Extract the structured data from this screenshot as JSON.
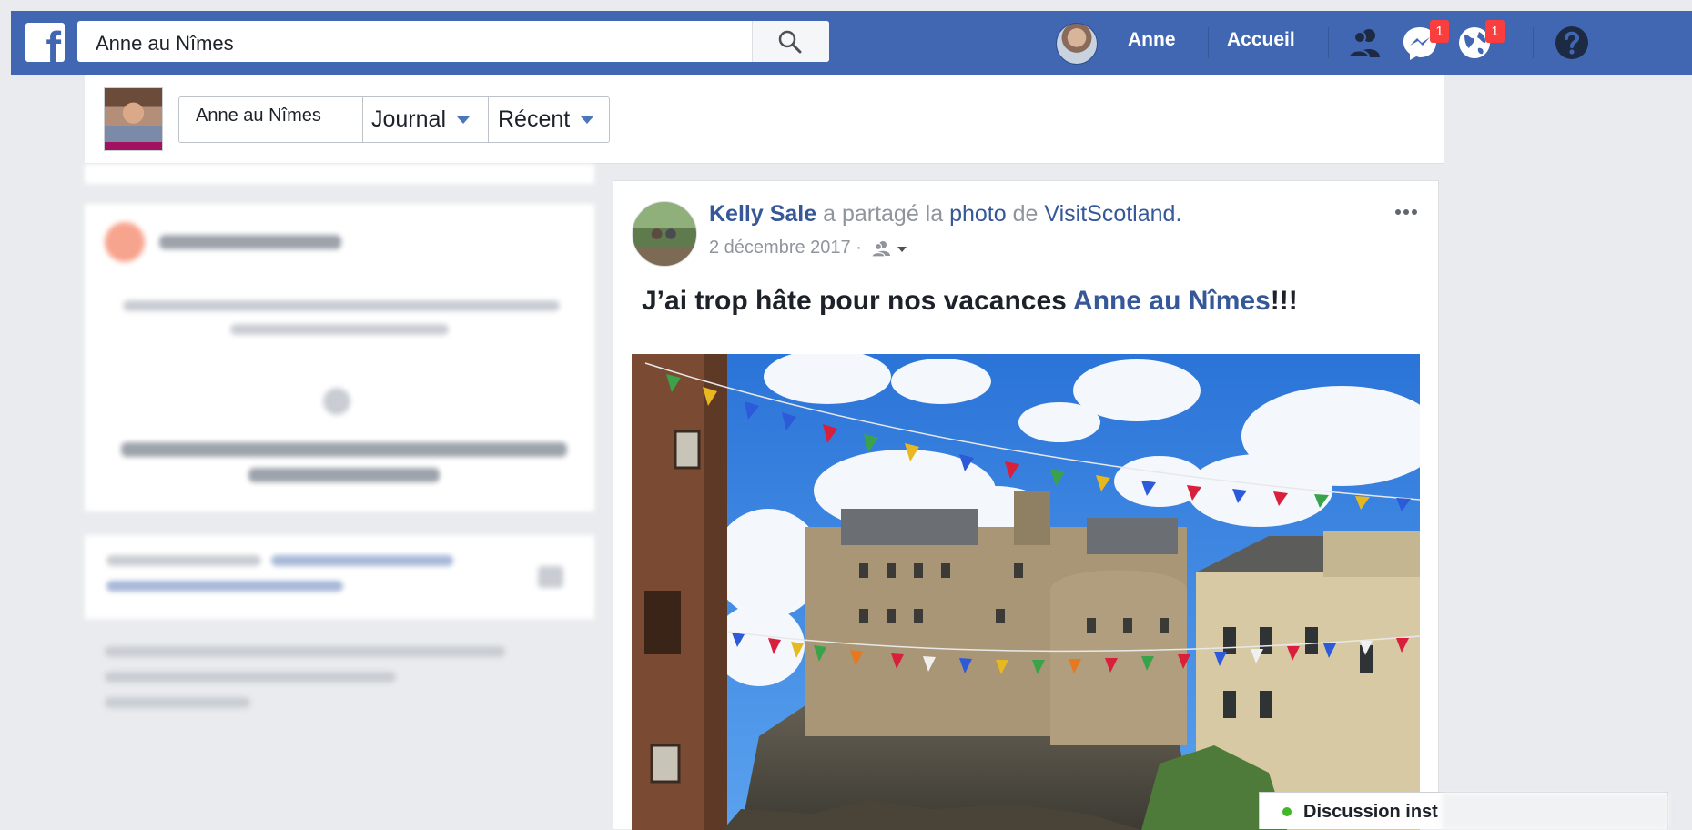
{
  "topbar": {
    "search_value": "Anne au Nîmes",
    "user_name": "Anne",
    "home_label": "Accueil",
    "messages_badge": "1",
    "notifications_badge": "1",
    "brand_color": "#4267b2"
  },
  "profile_bar": {
    "name": "Anne au Nîmes",
    "journal_label": "Journal",
    "recent_label": "Récent"
  },
  "post": {
    "author": "Kelly Sale",
    "action_text": "a partagé la",
    "photo_link": "photo",
    "of_text": "de",
    "page_link": "VisitScotland",
    "period": ".",
    "date": "2 décembre 2017",
    "date_sep": "·",
    "text_before": "J’ai trop hâte pour nos vacances ",
    "tagged_name": "Anne au Nîmes",
    "text_after": "!!!"
  },
  "chat": {
    "label": "Discussion inst"
  }
}
